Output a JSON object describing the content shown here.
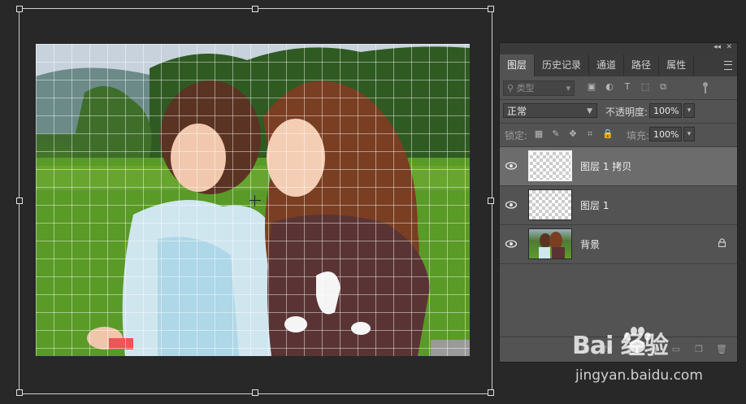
{
  "panel": {
    "tabs": [
      "图层",
      "历史记录",
      "通道",
      "路径",
      "属性"
    ],
    "filter": {
      "label": "类型"
    },
    "blend_mode": "正常",
    "opacity": {
      "label": "不透明度:",
      "value": "100%"
    },
    "lock": {
      "label": "锁定:"
    },
    "fill": {
      "label": "填充:",
      "value": "100%"
    },
    "layers": [
      {
        "name": "图层 1 拷贝",
        "selected": true,
        "thumb": "transparent"
      },
      {
        "name": "图层 1",
        "selected": false,
        "thumb": "transparent"
      },
      {
        "name": "背景",
        "selected": false,
        "thumb": "photo",
        "locked": true
      }
    ],
    "bottom_icons": [
      "link-icon",
      "fx-icon",
      "mask-icon",
      "adjustment-icon",
      "folder-icon",
      "new-layer-icon",
      "trash-icon"
    ]
  },
  "watermark": {
    "brand": "Bai 经验",
    "url": "jingyan.baidu.com"
  },
  "colors": {
    "workspace": "#282828",
    "panel": "#535353",
    "selected_layer": "#6c6c6c"
  }
}
